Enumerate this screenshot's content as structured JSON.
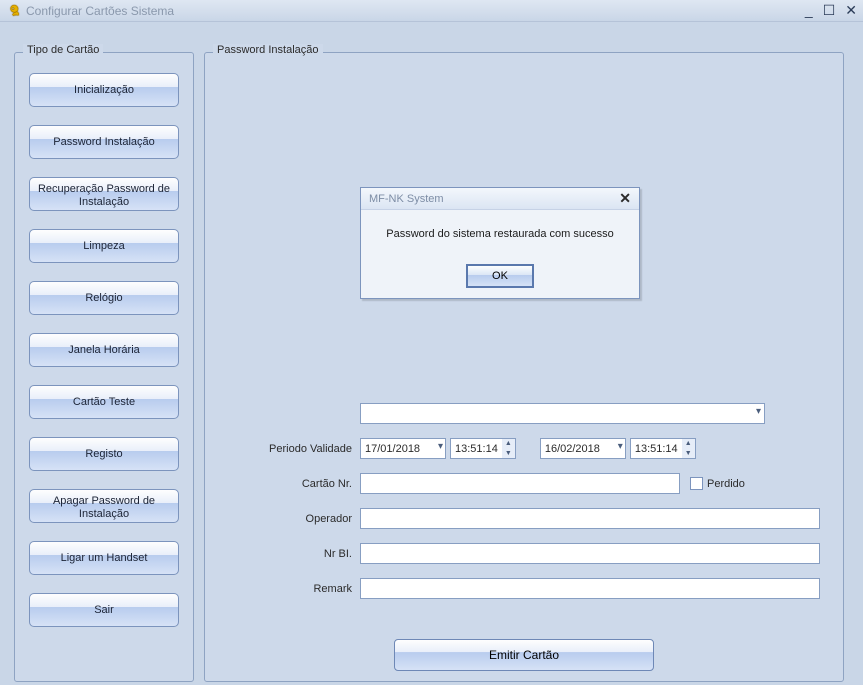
{
  "window": {
    "title": "Configurar Cartões Sistema",
    "minimize": "—",
    "maximize": "☐",
    "close": "✕"
  },
  "sidebar": {
    "legend": "Tipo de Cartão",
    "buttons": [
      "Inicialização",
      "Password Instalação",
      "Recuperação Password de Instalação",
      "Limpeza",
      "Relógio",
      "Janela Horária",
      "Cartão Teste",
      "Registo",
      "Apagar Password de Instalação",
      "Ligar um Handset",
      "Sair"
    ]
  },
  "main": {
    "legend": "Password Instalação",
    "labels": {
      "periodo": "Periodo Validade",
      "cartao": "Cartão Nr.",
      "operador": "Operador",
      "nrbi": "Nr BI.",
      "remark": "Remark",
      "perdido": "Perdido"
    },
    "fields": {
      "topSelect": "",
      "date_from": "17/01/2018",
      "time_from": "13:51:14",
      "date_to": "16/02/2018",
      "time_to": "13:51:14",
      "cartao": "",
      "operador": "",
      "nrbi": "",
      "remark": ""
    },
    "emit": "Emitir Cartão"
  },
  "dialog": {
    "title": "MF-NK System",
    "message": "Password do sistema restaurada com sucesso",
    "ok": "OK"
  }
}
